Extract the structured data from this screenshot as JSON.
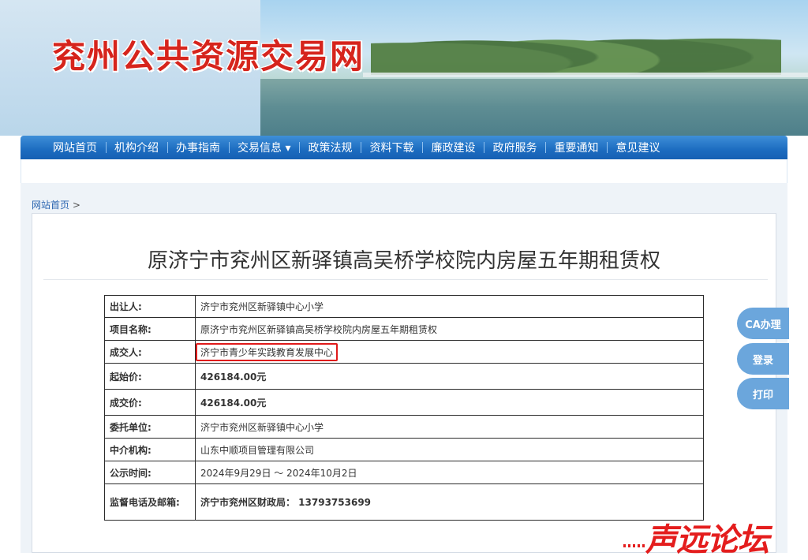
{
  "header": {
    "site_title": "兖州公共资源交易网"
  },
  "nav": {
    "items": [
      "网站首页",
      "机构介绍",
      "办事指南",
      "交易信息 ▾",
      "政策法规",
      "资料下载",
      "廉政建设",
      "政府服务",
      "重要通知",
      "意见建议"
    ]
  },
  "breadcrumb": {
    "home": "网站首页",
    "separator": ">"
  },
  "article": {
    "title": "原济宁市兖州区新驿镇高吴桥学校院内房屋五年期租赁权",
    "rows": [
      {
        "key": "出让人:",
        "value": "济宁市兖州区新驿镇中心小学"
      },
      {
        "key": "项目名称:",
        "value": "原济宁市兖州区新驿镇高吴桥学校院内房屋五年期租赁权"
      },
      {
        "key": "成交人:",
        "value": "济宁市青少年实践教育发展中心"
      },
      {
        "key": "起始价:",
        "value": "426184.00元"
      },
      {
        "key": "成交价:",
        "value": "426184.00元"
      },
      {
        "key": "委托单位:",
        "value": "济宁市兖州区新驿镇中心小学"
      },
      {
        "key": "中介机构:",
        "value": "山东中顺项目管理有限公司"
      },
      {
        "key": "公示时间:",
        "value": "2024年9月29日 ～ 2024年10月2日"
      },
      {
        "key": "监督电话及邮箱:",
        "value": "济宁市兖州区财政局： 13793753699"
      }
    ]
  },
  "side_buttons": {
    "ca": "CA办理",
    "login": "登录",
    "print": "打印"
  },
  "watermark": "声远论坛",
  "colors": {
    "nav": "#1c6cc0",
    "title_red": "#d6241c",
    "highlight": "#e01a1a",
    "side_button": "#6ba6dc"
  }
}
